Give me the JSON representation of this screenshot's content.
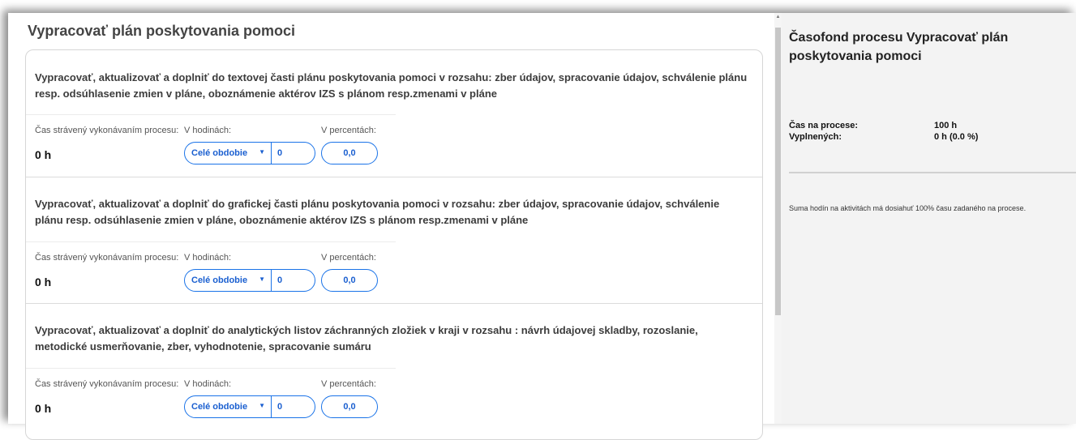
{
  "page": {
    "title": "Vypracovať plán poskytovania pomoci"
  },
  "labels": {
    "time_spent": "Čas strávený vykonávaním procesu:",
    "in_hours": "V hodinách:",
    "in_percent": "V percentách:"
  },
  "activities": [
    {
      "title": "Vypracovať, aktualizovať a doplniť do textovej časti plánu poskytovania pomoci v rozsahu: zber údajov, spracovanie údajov, schválenie plánu resp. odsúhlasenie zmien v pláne, oboznámenie aktérov IZS s plánom resp.zmenami v pláne",
      "hours": "0 h",
      "period": "Celé obdobie",
      "hours_value": "0",
      "percent_value": "0,0"
    },
    {
      "title": "Vypracovať, aktualizovať a doplniť do grafickej časti plánu poskytovania pomoci v rozsahu: zber údajov, spracovanie údajov, schválenie plánu resp. odsúhlasenie zmien v pláne, oboznámenie aktérov IZS s plánom resp.zmenami v pláne",
      "hours": "0 h",
      "period": "Celé obdobie",
      "hours_value": "0",
      "percent_value": "0,0"
    },
    {
      "title": "Vypracovať, aktualizovať a doplniť do analytických listov záchranných zložiek v kraji v rozsahu : návrh údajovej skladby, rozoslanie, metodické usmerňovanie, zber, vyhodnotenie, spracovanie sumáru",
      "hours": "0 h",
      "period": "Celé obdobie",
      "hours_value": "0",
      "percent_value": "0,0"
    }
  ],
  "sidebar": {
    "title": "Časofond procesu Vypracovať plán poskytovania pomoci",
    "time_on_process_label": "Čas na procese:",
    "time_on_process_value": "100 h",
    "filled_label": "Vyplnených:",
    "filled_value": "0 h (0.0 %)",
    "note": "Suma hodín na aktivitách má dosiahuť 100% času zadaného na procese."
  },
  "icons": {
    "dropdown": "chevron-down-icon",
    "scroll_up": "arrow-up-icon"
  },
  "colors": {
    "accent": "#1a73e8",
    "sidebar_bg": "#f3f3f3"
  }
}
